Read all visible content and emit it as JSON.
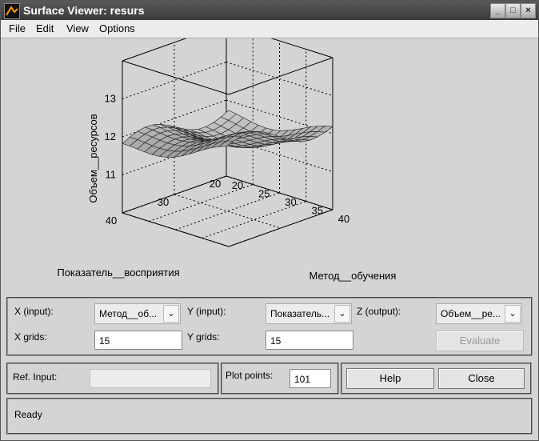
{
  "window": {
    "title": "Surface Viewer: resurs"
  },
  "menu": [
    "File",
    "Edit",
    "View",
    "Options"
  ],
  "chart_data": {
    "type": "surface",
    "zlabel": "Объем__ресурсов",
    "xlabel": "Метод__обучения",
    "ylabel": "Показатель__восприятия",
    "x_ticks": [
      "20",
      "25",
      "30",
      "35",
      "40"
    ],
    "y_ticks": [
      "20",
      "30",
      "40"
    ],
    "z_ticks": [
      "11",
      "12",
      "13"
    ],
    "xlim": [
      20,
      40
    ],
    "ylim": [
      20,
      40
    ],
    "zlim": [
      10,
      14
    ],
    "grid": true,
    "grid_points": 15
  },
  "controls": {
    "x_input_label": "X (input):",
    "x_input_value": "Метод__об...",
    "y_input_label": "Y (input):",
    "y_input_value": "Показатель...",
    "z_output_label": "Z (output):",
    "z_output_value": "Объем__ре...",
    "x_grids_label": "X grids:",
    "x_grids_value": "15",
    "y_grids_label": "Y grids:",
    "y_grids_value": "15",
    "evaluate_label": "Evaluate",
    "ref_input_label": "Ref. Input:",
    "ref_input_value": "",
    "plot_points_label": "Plot points:",
    "plot_points_value": "101",
    "help_label": "Help",
    "close_label": "Close"
  },
  "status": {
    "text": "Ready"
  },
  "icons": {
    "app": "matlab-icon",
    "minimize": "minimize-icon",
    "maximize": "maximize-icon",
    "close": "close-icon",
    "dropdown": "chevron-down-icon"
  }
}
